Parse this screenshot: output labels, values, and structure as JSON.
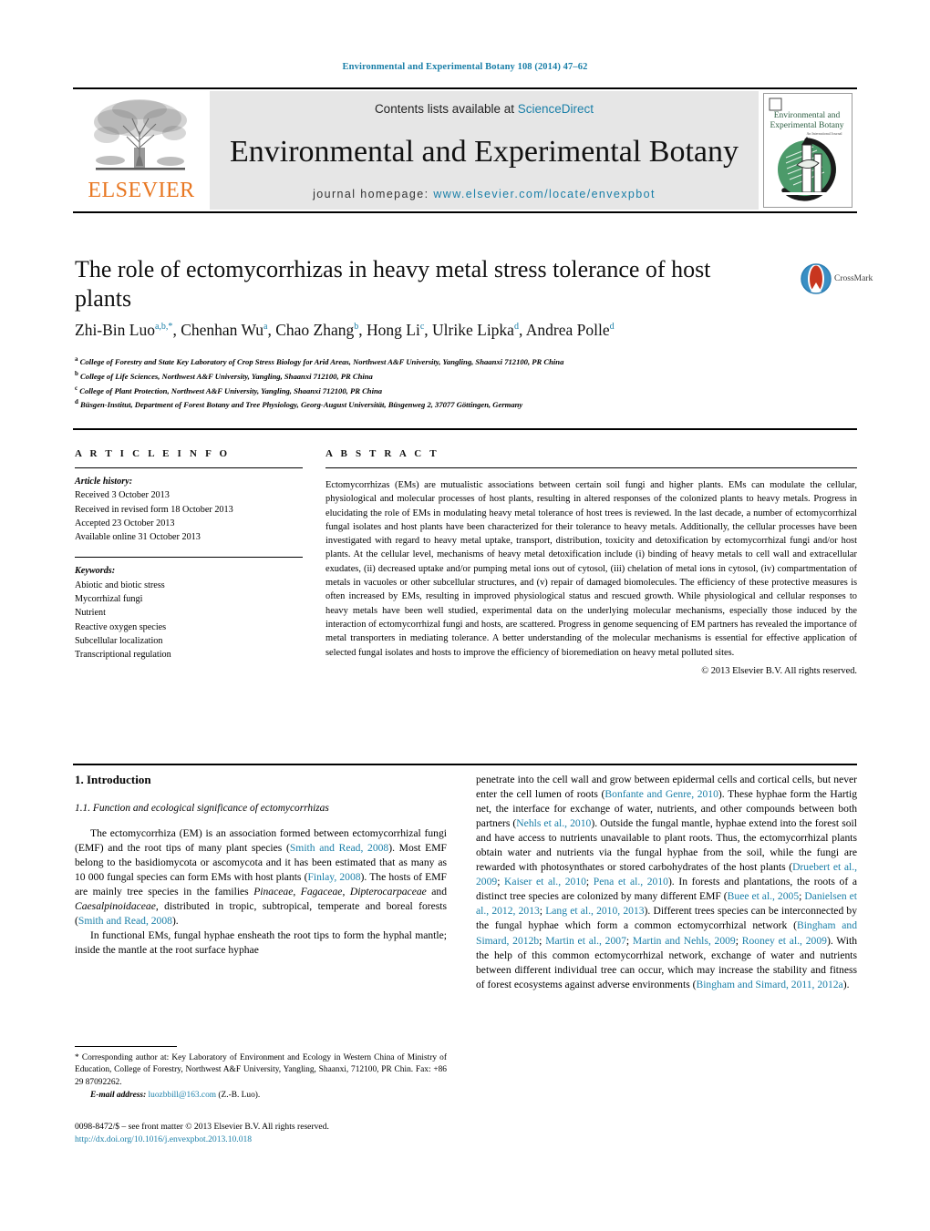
{
  "running_head": "Environmental and Experimental Botany 108 (2014) 47–62",
  "masthead": {
    "contents_prefix": "Contents lists available at ",
    "sciencedirect": "ScienceDirect",
    "journal_title": "Environmental and Experimental Botany",
    "homepage_prefix": "journal homepage: ",
    "homepage_url": "www.elsevier.com/locate/envexpbot",
    "publisher_wordmark": "ELSEVIER",
    "publisher_color": "#E87722",
    "cover_title_line1": "Environmental and",
    "cover_title_line2": "Experimental Botany",
    "link_color": "#1a7fa8"
  },
  "article": {
    "title": "The role of ectomycorrhizas in heavy metal stress tolerance of host plants",
    "crossmark_label": "CrossMark",
    "authors": [
      {
        "name": "Zhi-Bin Luo",
        "marks": "a,b,*"
      },
      {
        "name": "Chenhan Wu",
        "marks": "a"
      },
      {
        "name": "Chao Zhang",
        "marks": "b"
      },
      {
        "name": "Hong Li",
        "marks": "c"
      },
      {
        "name": "Ulrike Lipka",
        "marks": "d"
      },
      {
        "name": "Andrea Polle",
        "marks": "d"
      }
    ],
    "affiliations": [
      {
        "mark": "a",
        "text": "College of Forestry and State Key Laboratory of Crop Stress Biology for Arid Areas, Northwest A&F University, Yangling, Shaanxi 712100, PR China"
      },
      {
        "mark": "b",
        "text": "College of Life Sciences, Northwest A&F University, Yangling, Shaanxi 712100, PR China"
      },
      {
        "mark": "c",
        "text": "College of Plant Protection, Northwest A&F University, Yangling, Shaanxi 712100, PR China"
      },
      {
        "mark": "d",
        "text": "Büsgen-Institut, Department of Forest Botany and Tree Physiology, Georg-August Universität, Büsgenweg 2, 37077 Göttingen, Germany"
      }
    ]
  },
  "article_info": {
    "heading": "A R T I C L E   I N F O",
    "history_label": "Article history:",
    "history": [
      "Received 3 October 2013",
      "Received in revised form 18 October 2013",
      "Accepted 23 October 2013",
      "Available online 31 October 2013"
    ],
    "keywords_label": "Keywords:",
    "keywords": [
      "Abiotic and biotic stress",
      "Mycorrhizal fungi",
      "Nutrient",
      "Reactive oxygen species",
      "Subcellular localization",
      "Transcriptional regulation"
    ]
  },
  "abstract": {
    "heading": "A B S T R A C T",
    "text": "Ectomycorrhizas (EMs) are mutualistic associations between certain soil fungi and higher plants. EMs can modulate the cellular, physiological and molecular processes of host plants, resulting in altered responses of the colonized plants to heavy metals. Progress in elucidating the role of EMs in modulating heavy metal tolerance of host trees is reviewed. In the last decade, a number of ectomycorrhizal fungal isolates and host plants have been characterized for their tolerance to heavy metals. Additionally, the cellular processes have been investigated with regard to heavy metal uptake, transport, distribution, toxicity and detoxification by ectomycorrhizal fungi and/or host plants. At the cellular level, mechanisms of heavy metal detoxification include (i) binding of heavy metals to cell wall and extracellular exudates, (ii) decreased uptake and/or pumping metal ions out of cytosol, (iii) chelation of metal ions in cytosol, (iv) compartmentation of metals in vacuoles or other subcellular structures, and (v) repair of damaged biomolecules. The efficiency of these protective measures is often increased by EMs, resulting in improved physiological status and rescued growth. While physiological and cellular responses to heavy metals have been well studied, experimental data on the underlying molecular mechanisms, especially those induced by the interaction of ectomycorrhizal fungi and hosts, are scattered. Progress in genome sequencing of EM partners has revealed the importance of metal transporters in mediating tolerance. A better understanding of the molecular mechanisms is essential for effective application of selected fungal isolates and hosts to improve the efficiency of bioremediation on heavy metal polluted sites.",
    "copyright": "© 2013 Elsevier B.V. All rights reserved."
  },
  "body": {
    "section_heading": "1.  Introduction",
    "subsection_heading": "1.1.  Function and ecological significance of ectomycorrhizas",
    "left_paragraphs": [
      "The ectomycorrhiza (EM) is an association formed between ectomycorrhizal fungi (EMF) and the root tips of many plant species (Smith and Read, 2008). Most EMF belong to the basidiomycota or ascomycota and it has been estimated that as many as 10 000 fungal species can form EMs with host plants (Finlay, 2008). The hosts of EMF are mainly tree species in the families Pinaceae, Fagaceae, Dipterocarpaceae and Caesalpinoidaceae, distributed in tropic, subtropical, temperate and boreal forests (Smith and Read, 2008).",
      "In functional EMs, fungal hyphae ensheath the root tips to form the hyphal mantle; inside the mantle at the root surface hyphae"
    ],
    "right_paragraphs": [
      "penetrate into the cell wall and grow between epidermal cells and cortical cells, but never enter the cell lumen of roots (Bonfante and Genre, 2010). These hyphae form the Hartig net, the interface for exchange of water, nutrients, and other compounds between both partners (Nehls et al., 2010). Outside the fungal mantle, hyphae extend into the forest soil and have access to nutrients unavailable to plant roots. Thus, the ectomycorrhizal plants obtain water and nutrients via the fungal hyphae from the soil, while the fungi are rewarded with photosynthates or stored carbohydrates of the host plants (Druebert et al., 2009; Kaiser et al., 2010; Pena et al., 2010). In forests and plantations, the roots of a distinct tree species are colonized by many different EMF (Buee et al., 2005; Danielsen et al., 2012, 2013; Lang et al., 2010, 2013). Different trees species can be interconnected by the fungal hyphae which form a common ectomycorrhizal network (Bingham and Simard, 2012b; Martin et al., 2007; Martin and Nehls, 2009; Rooney et al., 2009). With the help of this common ectomycorrhizal network, exchange of water and nutrients between different individual tree can occur, which may increase the stability and fitness of forest ecosystems against adverse environments (Bingham and Simard, 2011, 2012a)."
    ]
  },
  "footnotes": {
    "corresponding": "* Corresponding author at: Key Laboratory of Environment and Ecology in Western China of Ministry of Education, College of Forestry, Northwest A&F University, Yangling, Shaanxi, 712100, PR Chin. Fax: +86 29 87092262.",
    "email_label": "E-mail address:",
    "email": "luozbbill@163.com",
    "email_suffix": "(Z.-B. Luo)."
  },
  "imprint": {
    "issn_line": "0098-8472/$ – see front matter © 2013 Elsevier B.V. All rights reserved.",
    "doi": "http://dx.doi.org/10.1016/j.envexpbot.2013.10.018"
  }
}
